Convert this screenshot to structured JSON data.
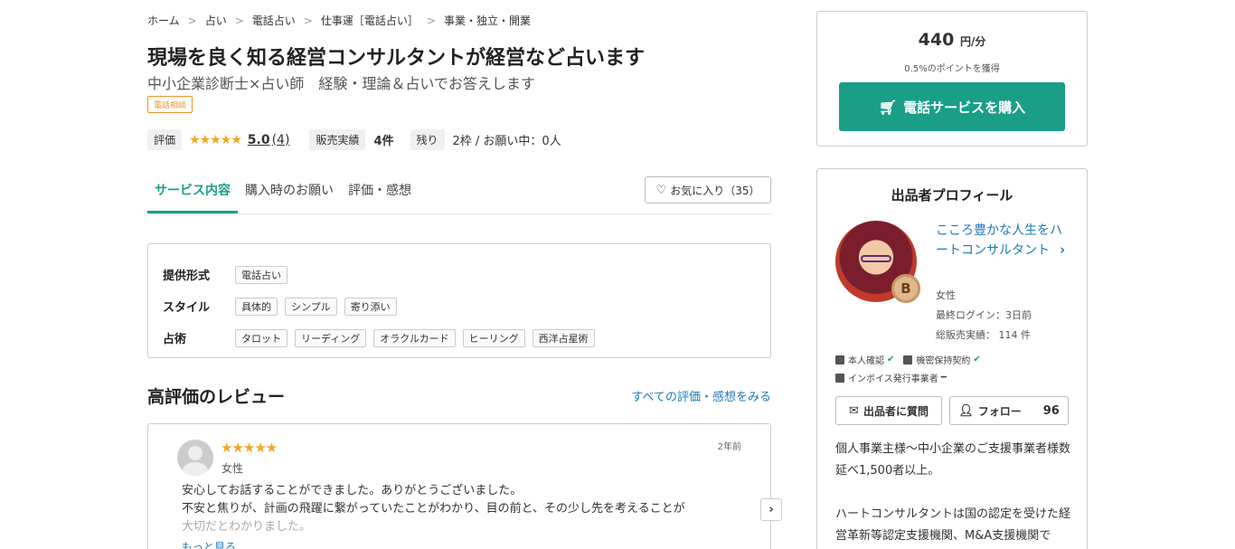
{
  "breadcrumb": [
    "ホーム",
    "占い",
    "電話占い",
    "仕事運［電話占い］",
    "事業・独立・開業"
  ],
  "title": "現場を良く知る経営コンサルタントが経営など占います",
  "subtitle": "中小企業診断士×占い師　経験・理論＆占いでお答えします",
  "category_badge": "電話相談",
  "stats": {
    "rating_label": "評価",
    "rating_stars": "★★★★★",
    "rating_value": "5.0",
    "rating_count": "(4)",
    "rating": 5.0,
    "sales_label": "販売実績",
    "sales_value": "4件",
    "remaining_label": "残り",
    "remaining_value": "2枠 / お願い中：0人"
  },
  "tabs": [
    "サービス内容",
    "購入時のお願い",
    "評価・感想"
  ],
  "favorite_label": "お気に入り（35）",
  "details": {
    "format_label": "提供形式",
    "format_chips": [
      "電話占い"
    ],
    "style_label": "スタイル",
    "style_chips": [
      "具体的",
      "シンプル",
      "寄り添い"
    ],
    "method_label": "占術",
    "method_chips": [
      "タロット",
      "リーディング",
      "オラクルカード",
      "ヒーリング",
      "西洋占星術"
    ]
  },
  "review_section": {
    "title": "高評価のレビュー",
    "see_all": "すべての評価・感想をみる",
    "review": {
      "stars": "★★★★★",
      "rating": 5,
      "gender": "女性",
      "date": "2年前",
      "line1": "安心してお話することができました。ありがとうございました。",
      "line2": "不安と焦りが、計画の飛躍に繋がっていたことがわかり、目の前と、その少し先を考えることが",
      "line3": "大切だとわかりました。",
      "more": "もっと見る"
    },
    "next_icon": "chevron-right-icon"
  },
  "purchase": {
    "price": "440",
    "price_unit": "円/分",
    "points": "0.5%のポイントを獲得",
    "buy_label": "電話サービスを購入",
    "cart_icon": "cart-icon"
  },
  "profile": {
    "title": "出品者プロフィール",
    "seller_name": "こころ豊かな人生をハートコンサルタント",
    "badge": "B",
    "gender": "女性",
    "last_login": "最終ログイン：3日前",
    "total_sales": "総販売実績： 114 件",
    "identity": "本人確認",
    "nda": "機密保持契約",
    "invoice": "インボイス発行事業者",
    "ask_label": "出品者に質問",
    "follow_label": "フォロー",
    "follow_count": "96",
    "desc_line1": "個人事業主様〜中小企業のご支援事業者様数延べ1,500者以上。",
    "desc_line2": "ハートコンサルタントは国の認定を受けた経営革新等認定支援機関、M&A支援機関です。"
  },
  "colors": {
    "accent": "#1a9e87",
    "link": "#1e7ab8",
    "star": "#f5a623",
    "badge_orange": "#e8952e"
  }
}
